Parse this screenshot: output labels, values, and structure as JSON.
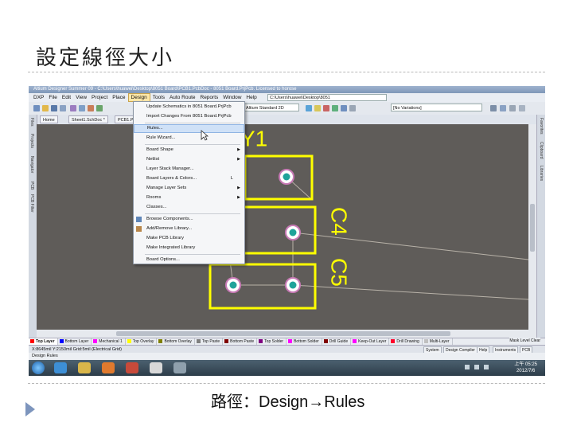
{
  "slide": {
    "title": "設定線徑大小",
    "caption": "路徑：Design→Rules"
  },
  "app": {
    "window_title": "Altium Designer Summer 09 - C:\\Users\\huawei\\Desktop\\8051 Board\\PCB1.PcbDoc - 8051 Board.PrjPcb. Licensed to horose",
    "menus": [
      "DXP",
      "File",
      "Edit",
      "View",
      "Project",
      "Place",
      "Design",
      "Tools",
      "Auto Route",
      "Reports",
      "Window",
      "Help"
    ],
    "active_menu": "Design",
    "path_box": "C:\\Users\\huawei\\Desktop\\8051",
    "standard_combo": "Altium Standard 2D",
    "variants_combo": "[No Variations]",
    "doc_tabs": [
      "Home",
      "Sheet1.SchDoc *",
      "PCB1.PcbDoc"
    ],
    "left_panels": [
      "Files",
      "Projects",
      "Navigator",
      "PCB",
      "PCB Filter"
    ],
    "right_panels": [
      "Favorites",
      "Clipboard",
      "Libraries"
    ]
  },
  "design_menu": {
    "items": [
      {
        "label": "Update Schematics in 8051 Board.PrjPcb",
        "submenu": false,
        "shortcut": "",
        "icon": ""
      },
      {
        "label": "Import Changes From 8051 Board.PrjPcb",
        "submenu": false,
        "shortcut": "",
        "icon": ""
      },
      {
        "label": "Rules...",
        "submenu": false,
        "shortcut": "",
        "icon": "",
        "highlighted": true
      },
      {
        "label": "Rule Wizard...",
        "submenu": false,
        "shortcut": "",
        "icon": ""
      },
      {
        "label": "Board Shape",
        "submenu": true,
        "shortcut": "",
        "icon": ""
      },
      {
        "label": "Netlist",
        "submenu": true,
        "shortcut": "",
        "icon": ""
      },
      {
        "label": "Layer Stack Manager...",
        "submenu": false,
        "shortcut": "",
        "icon": ""
      },
      {
        "label": "Board Layers & Colors...",
        "submenu": false,
        "shortcut": "L",
        "icon": ""
      },
      {
        "label": "Manage Layer Sets",
        "submenu": true,
        "shortcut": "",
        "icon": ""
      },
      {
        "label": "Rooms",
        "submenu": true,
        "shortcut": "",
        "icon": ""
      },
      {
        "label": "Classes...",
        "submenu": false,
        "shortcut": "",
        "icon": ""
      },
      {
        "label": "Browse Components...",
        "submenu": false,
        "shortcut": "",
        "icon": "component-browse-icon"
      },
      {
        "label": "Add/Remove Library...",
        "submenu": false,
        "shortcut": "",
        "icon": "library-icon"
      },
      {
        "label": "Make PCB Library",
        "submenu": false,
        "shortcut": "",
        "icon": ""
      },
      {
        "label": "Make Integrated Library",
        "submenu": false,
        "shortcut": "",
        "icon": ""
      },
      {
        "label": "Board Options...",
        "submenu": false,
        "shortcut": "",
        "icon": ""
      }
    ]
  },
  "pcb": {
    "designators": [
      "Y1",
      "C4",
      "C5"
    ],
    "colors": {
      "canvas": "#5f5c59",
      "silkscreen": "#ffff00",
      "pad": "#1fa39a",
      "pad_ring": "#c87ab6",
      "ratsnest": "#b8b2a8"
    }
  },
  "layers": [
    {
      "name": "Top Layer",
      "color": "#ff0000",
      "active": true
    },
    {
      "name": "Bottom Layer",
      "color": "#0000ff",
      "active": false
    },
    {
      "name": "Mechanical 1",
      "color": "#ff00ff",
      "active": false
    },
    {
      "name": "Top Overlay",
      "color": "#ffff00",
      "active": false
    },
    {
      "name": "Bottom Overlay",
      "color": "#808000",
      "active": false
    },
    {
      "name": "Top Paste",
      "color": "#808080",
      "active": false
    },
    {
      "name": "Bottom Paste",
      "color": "#800000",
      "active": false
    },
    {
      "name": "Top Solder",
      "color": "#800080",
      "active": false
    },
    {
      "name": "Bottom Solder",
      "color": "#ff00ff",
      "active": false
    },
    {
      "name": "Drill Guide",
      "color": "#800000",
      "active": false
    },
    {
      "name": "Keep-Out Layer",
      "color": "#ff00ff",
      "active": false
    },
    {
      "name": "Drill Drawing",
      "color": "#ff002a",
      "active": false
    },
    {
      "name": "Multi-Layer",
      "color": "#c0c0c0",
      "active": false
    }
  ],
  "layer_tools": "Mask Level  Clear",
  "status": {
    "coords": "X:8645mil Y:2150mil   Grid:5mil   (Electrical Grid)",
    "buttons": [
      "System",
      "Design Compiler",
      "Help",
      "Instruments",
      "PCB"
    ],
    "hint": "Design Rules"
  },
  "taskbar": {
    "time": "上午 05:25",
    "date": "2012/7/6"
  }
}
